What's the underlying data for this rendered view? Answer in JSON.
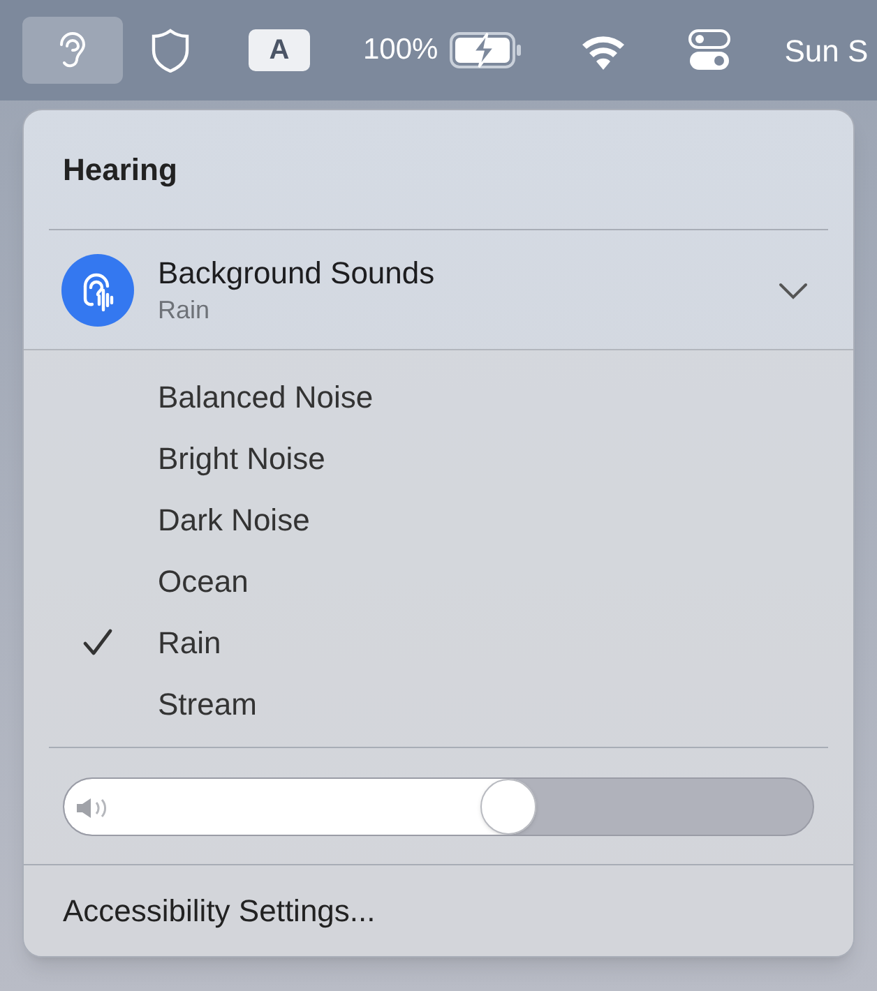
{
  "menu_bar": {
    "items": [
      {
        "kind": "ear",
        "selected": true
      },
      {
        "kind": "shield",
        "selected": false
      },
      {
        "kind": "input",
        "label": "A",
        "selected": false
      },
      {
        "kind": "battery",
        "label": "100%",
        "selected": false
      },
      {
        "kind": "wifi",
        "selected": false
      },
      {
        "kind": "controls",
        "selected": false
      },
      {
        "kind": "clock",
        "label": "Sun S",
        "selected": false
      }
    ]
  },
  "panel": {
    "title": "Hearing",
    "feature": {
      "title": "Background Sounds",
      "subtitle": "Rain",
      "expanded": true
    },
    "sounds": [
      {
        "label": "Balanced Noise",
        "selected": false
      },
      {
        "label": "Bright Noise",
        "selected": false
      },
      {
        "label": "Dark Noise",
        "selected": false
      },
      {
        "label": "Ocean",
        "selected": false
      },
      {
        "label": "Rain",
        "selected": true
      },
      {
        "label": "Stream",
        "selected": false
      }
    ],
    "volume": {
      "level": 0.63
    },
    "footer": "Accessibility Settings..."
  }
}
